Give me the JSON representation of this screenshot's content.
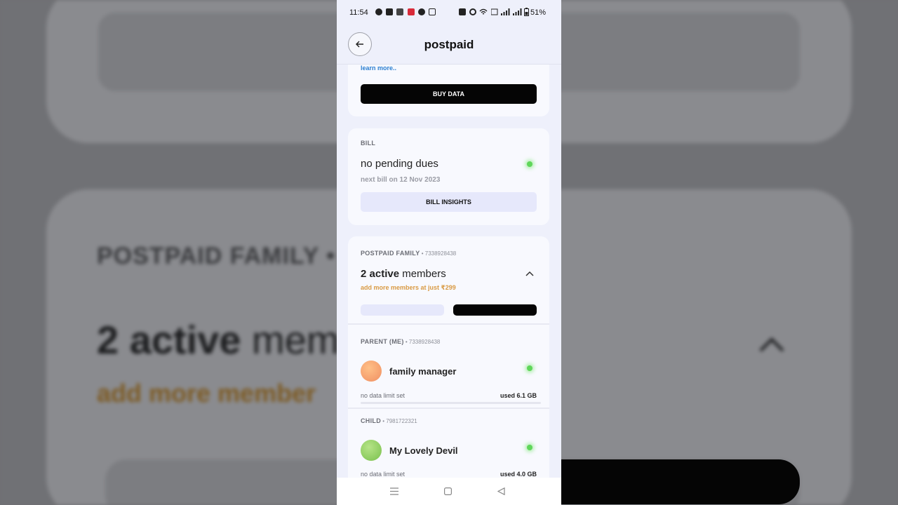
{
  "status_bar": {
    "time": "11:54",
    "battery": "51%"
  },
  "header": {
    "title": "postpaid"
  },
  "data_card": {
    "learn_more": "learn more..",
    "buy_button": "BUY DATA"
  },
  "bill_card": {
    "label": "BILL",
    "status": "no pending dues",
    "next_bill": "next bill on 12 Nov 2023",
    "insights_button": "BILL INSIGHTS"
  },
  "family_card": {
    "label": "POSTPAID FAMILY",
    "number": " • 7338928438",
    "active_count": "2 active",
    "members_word": " members",
    "add_more": "add more members at just ₹299",
    "members": [
      {
        "role": "PARENT (ME)",
        "number": " • 7338928438",
        "name": "family manager",
        "limit": "no data limit set",
        "used": "used 6.1 GB",
        "avatar_color": "#f5a371"
      },
      {
        "role": "CHILD",
        "number": " • 7981722321",
        "name": "My Lovely Devil",
        "limit": "no data limit set",
        "used": "used 4.0 GB",
        "avatar_color": "#8ed064"
      }
    ]
  },
  "background": {
    "label": "POSTPAID FAMILY •",
    "active_count": "2 active",
    "members_word": " mem",
    "add_more": "add more member"
  }
}
